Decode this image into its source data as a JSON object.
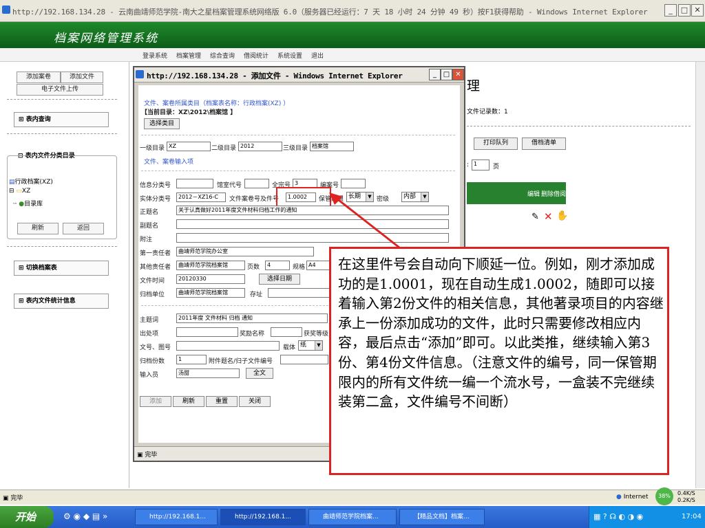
{
  "window": {
    "title": "http://192.168.134.28 - 云南曲靖师范学院-南大之星档案管理系统网络版 6.0（服务器已经运行：7 天 18 小时 24 分钟 49 秒）按F1获得帮助 - Windows Internet Explorer"
  },
  "app": {
    "title": "档案网络管理系统",
    "menu": [
      "登录系统",
      "档案管理",
      "综合查询",
      "借阅统计",
      "系统设置",
      "退出"
    ]
  },
  "sidebar": {
    "add_folder": "添加案卷",
    "add_file": "添加文件",
    "e_upload": "电子文件上传",
    "query": "表内查询",
    "catalog": "表内文件分类目录",
    "tree_root": "行政档案(XZ)",
    "tree_child": "XZ",
    "tree_leaf": "目录库",
    "refresh": "刷新",
    "back": "返回",
    "switch": "切换档案表",
    "stats": "表内文件统计信息"
  },
  "background_page": {
    "title_frag": "理",
    "record_count": "文件记录数：1",
    "btn_print": "打印队列",
    "btn_borrow": "借档清单",
    "page_label": "页",
    "page_value": "1",
    "col_edit": "编辑",
    "col_delete": "删除",
    "col_borrow": "借阅"
  },
  "popup": {
    "title": "http://192.168.134.28 - 添加文件 - Windows Internet Explorer",
    "section1": "文件、案卷所属类目（档案表名称：行政档案(XZ) ）",
    "current_catalog": "【当前目录：XZ\\2012\\档案馆 】",
    "choose_catalog": "选择类目",
    "level1_label": "一级目录",
    "level1_value": "XZ",
    "level2_label": "二级目录",
    "level2_value": "2012",
    "level3_label": "三级目录",
    "level3_value": "档案馆",
    "section2": "文件、案卷输入项",
    "info_class": "信息分类号",
    "room_code": "馆室代号",
    "fonds_no": "全宗号",
    "fonds_value": "3",
    "catalog_no": "编案号",
    "entity_class": "实体分类号",
    "entity_value": "2012－XZ16-C",
    "file_no_label": "文件案卷号及件号",
    "file_no_value": "1.0002",
    "retention_label": "保管期限",
    "retention_value": "长期",
    "secret_label": "密级",
    "secret_value": "内部",
    "title_label": "正题名",
    "title_value": "关于认真做好2011年度文件材料归档工作的通知",
    "subtitle_label": "副题名",
    "note_label": "附注",
    "resp1_label": "第一责任者",
    "resp1_value": "曲靖师范学院办公室",
    "resp_other_label": "其他责任者",
    "resp_other_value": "曲靖师范学院档案馆",
    "pages_label": "页数",
    "pages_value": "4",
    "spec_label": "规格",
    "spec_value": "A4",
    "date_label": "文件时间",
    "date_value": "20120330",
    "choose_date": "选择日期",
    "archive_unit_label": "归档单位",
    "archive_unit_value": "曲靖师范学院档案馆",
    "storage_label": "存址",
    "subject_label": "主题词",
    "subject_value": "2011年度  文件材料  归档  通知",
    "source_label": "出处项",
    "award_label": "奖励名称",
    "award_grade_label": "获奖等级",
    "doc_no_label": "文号、图号",
    "carrier_label": "载体",
    "carrier_value": "纸",
    "copies_label": "归档份数",
    "copies_value": "1",
    "attach_label": "附件题名/归子文件编号",
    "input_label": "输入员",
    "input_value": "汤甜",
    "fulltext": "全文",
    "btn_add": "添加",
    "btn_refresh": "刷新",
    "btn_reset": "重置",
    "btn_close": "关闭",
    "status": "完毕"
  },
  "callout": {
    "text": "在这里件号会自动向下顺延一位。例如，刚才添加成功的是1.0001，现在自动生成1.0002，随即可以接着输入第2份文件的相关信息，其他著录项目的内容继承上一份添加成功的文件，此时只需要修改相应内容，最后点击“添加”即可。以此类推，继续输入第3份、第4份文件信息。（注意文件的编号，同一保管期限内的所有文件统一编一个流水号，一盒装不完继续装第二盒，文件编号不间断）"
  },
  "statusbar": {
    "status": "完毕",
    "zone": "Internet",
    "progress": "38%",
    "up": "0.4K/S",
    "down": "0.2K/S"
  },
  "taskbar": {
    "start": "开始",
    "tasks": [
      "http://192.168.1...",
      "http://192.168.1...",
      "曲靖师范学院档案...",
      "【精品文档】档案..."
    ],
    "clock": "17:04"
  },
  "colors": {
    "header_green": "#1f8a2c",
    "callout_red": "#dd2222",
    "taskbar_blue": "#245bc6"
  }
}
